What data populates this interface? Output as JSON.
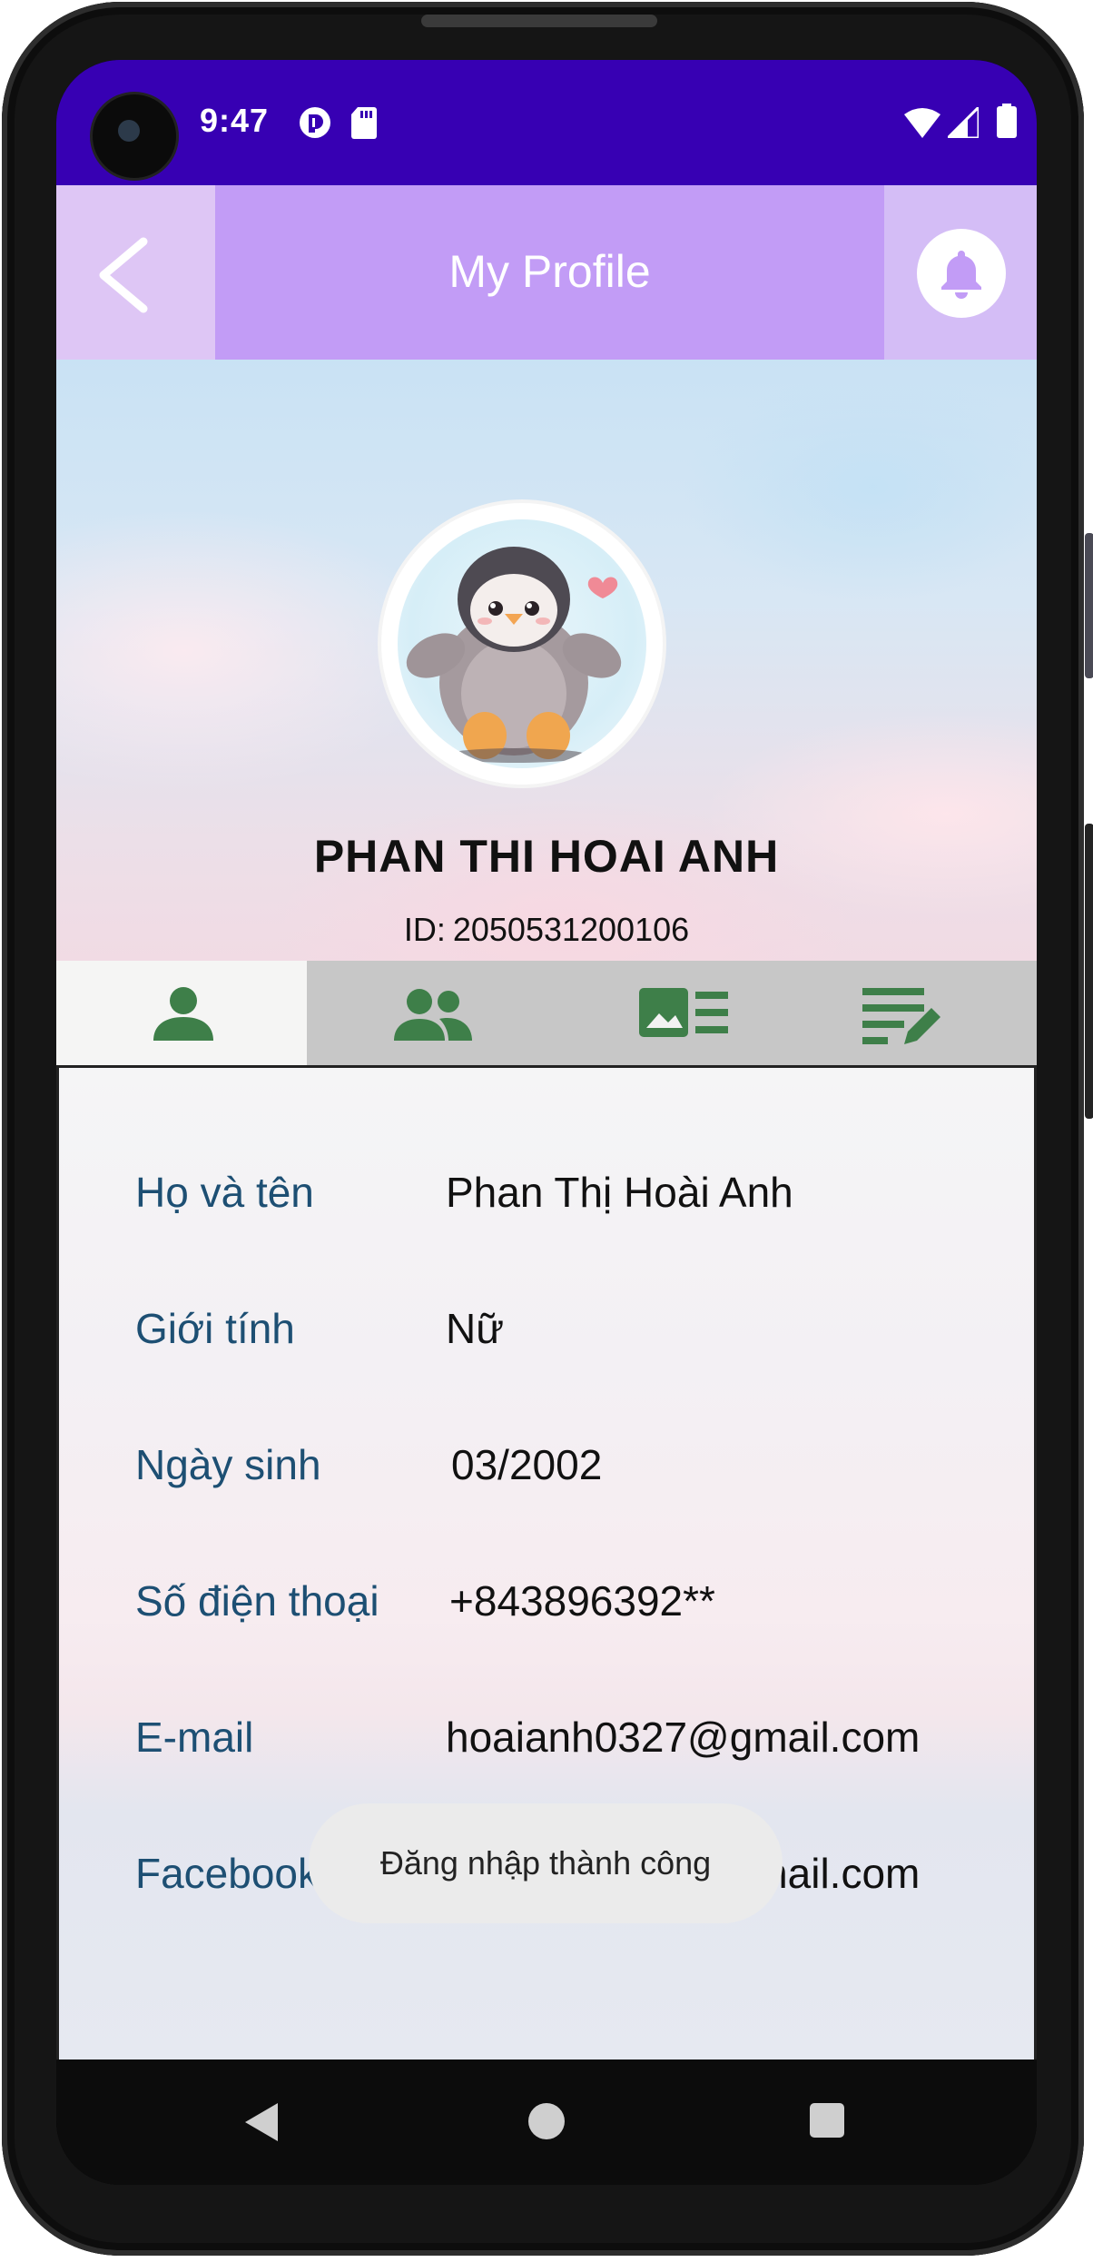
{
  "status_bar": {
    "time": "9:47",
    "left_icons": [
      "notification-app-icon",
      "sd-card-icon"
    ],
    "right_icons": [
      "wifi-icon",
      "signal-icon",
      "battery-icon"
    ]
  },
  "app_bar": {
    "title": "My Profile",
    "back_icon": "chevron-left-icon",
    "notification_icon": "bell-icon"
  },
  "profile": {
    "avatar": "penguin-avatar",
    "name": "PHAN THI HOAI ANH",
    "id_label": "ID:",
    "id_value": "2050531200106"
  },
  "tabs": [
    {
      "icon": "person-icon",
      "active": true
    },
    {
      "icon": "people-icon",
      "active": false
    },
    {
      "icon": "image-list-icon",
      "active": false
    },
    {
      "icon": "edit-note-icon",
      "active": false
    }
  ],
  "info_rows": [
    {
      "label": "Họ và tên",
      "value": "Phan Thị Hoài Anh"
    },
    {
      "label": "Giới tính",
      "value": "Nữ"
    },
    {
      "label": "Ngày sinh",
      "value": "03/2002"
    },
    {
      "label": "Số điện thoại",
      "value": "+843896392**"
    },
    {
      "label": "E-mail",
      "value": "hoaianh0327@gmail.com"
    },
    {
      "label": "Facebook",
      "value": "hoaianh0327@gmail.com"
    }
  ],
  "toast": {
    "message": "Đăng nhập thành công"
  },
  "nav_bar": {
    "icons": [
      "back-triangle-icon",
      "home-circle-icon",
      "recents-square-icon"
    ]
  },
  "colors": {
    "status_bar": "#3700b3",
    "app_bar_title_area": "#c29cf6",
    "app_bar_back_area": "#dec6f5",
    "app_bar_bell_area": "#d4bdf6",
    "tab_icon": "#3e7f49",
    "label_text": "#1d4f73"
  }
}
